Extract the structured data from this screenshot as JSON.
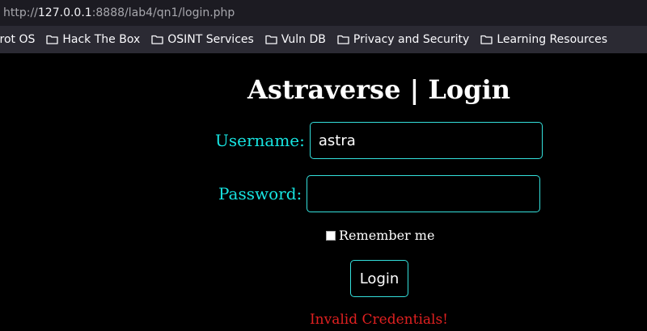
{
  "browser": {
    "url_scheme": "http://",
    "url_host": "127.0.0.1",
    "url_rest": ":8888/lab4/qn1/login.php"
  },
  "bookmarks": [
    {
      "label": "rrot OS",
      "icon": "none"
    },
    {
      "label": "Hack The Box",
      "icon": "folder-icon"
    },
    {
      "label": "OSINT Services",
      "icon": "folder-icon"
    },
    {
      "label": "Vuln DB",
      "icon": "folder-icon"
    },
    {
      "label": "Privacy and Security",
      "icon": "folder-icon"
    },
    {
      "label": "Learning Resources",
      "icon": "folder-icon"
    }
  ],
  "page": {
    "title": "Astraverse | Login",
    "username_label": "Username:",
    "username_value": "astra",
    "password_label": "Password:",
    "password_value": "",
    "remember_label": "Remember me",
    "remember_checked": false,
    "login_button": "Login",
    "error_message": "Invalid Credentials!"
  },
  "colors": {
    "background": "#000000",
    "label_accent": "#17e3e0",
    "field_border": "#34e0dc",
    "error": "#e02020"
  }
}
